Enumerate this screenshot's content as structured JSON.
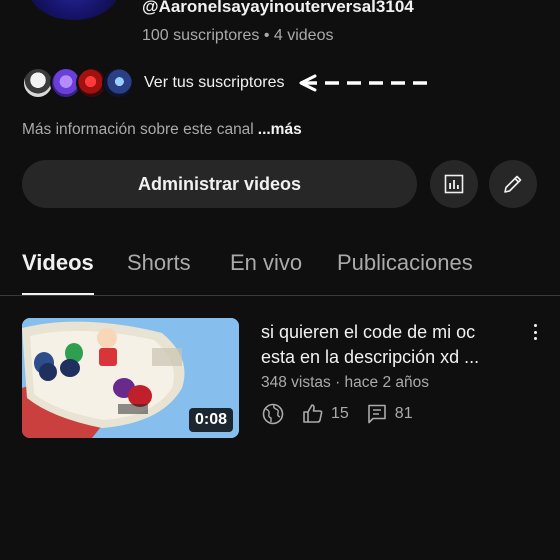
{
  "channel": {
    "handle": "@Aaronelsayayinouterversal3104",
    "stats": "100 suscriptores • 4 videos",
    "subscribers_link": "Ver tus suscriptores",
    "more_info": "Más información sobre este canal",
    "more_label": "...más"
  },
  "actions": {
    "manage_videos": "Administrar videos",
    "analytics_icon": "analytics-icon",
    "edit_icon": "pencil-icon"
  },
  "tabs": [
    {
      "label": "Videos",
      "active": true
    },
    {
      "label": "Shorts",
      "active": false
    },
    {
      "label": "En vivo",
      "active": false
    },
    {
      "label": "Publicaciones",
      "active": false
    }
  ],
  "videos": [
    {
      "title_line1": "si quieren el code de mi oc",
      "title_line2": "esta en la descripción xd ...",
      "meta": "348 vistas · hace 2 años",
      "duration": "0:08",
      "likes": "15",
      "comments": "81",
      "visibility_icon": "globe-icon"
    }
  ],
  "colors": {
    "background": "#0f0f0f",
    "surface": "#272727",
    "text_primary": "#f1f1f1",
    "text_secondary": "#aaaaaa"
  }
}
